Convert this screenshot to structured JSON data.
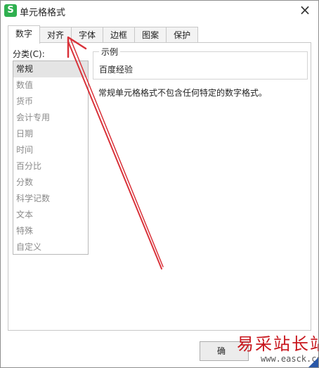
{
  "window": {
    "title": "单元格格式",
    "app_icon": "S",
    "close": "×"
  },
  "tabs": [
    {
      "label": "数字"
    },
    {
      "label": "对齐"
    },
    {
      "label": "字体"
    },
    {
      "label": "边框"
    },
    {
      "label": "图案"
    },
    {
      "label": "保护"
    }
  ],
  "category": {
    "label": "分类(C):",
    "items": [
      "常规",
      "数值",
      "货币",
      "会计专用",
      "日期",
      "时间",
      "百分比",
      "分数",
      "科学记数",
      "文本",
      "特殊",
      "自定义"
    ],
    "selected": "常规"
  },
  "sample": {
    "legend": "示例",
    "value": "百度经验"
  },
  "description": "常规单元格格式不包含任何特定的数字格式。",
  "buttons": {
    "ok": "确"
  },
  "annotation": {
    "color": "#d9323a"
  },
  "watermark": {
    "text": "易采站长站",
    "url": "www.easck.com"
  }
}
